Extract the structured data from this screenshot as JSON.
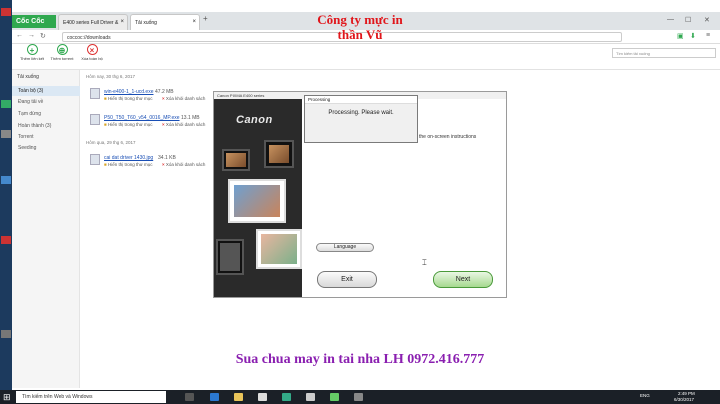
{
  "overlay": {
    "title_line1": "Công ty mực in",
    "title_line2": "thần Vũ",
    "bottom_text": "Sua chua may in tai nha LH 0972.416.777"
  },
  "browser": {
    "logo": "Cốc Cốc",
    "tabs": [
      {
        "label": "E400 series Full Driver &"
      },
      {
        "label": "Tải xuống"
      }
    ],
    "new_tab": "+",
    "url": "coccoc://downloads",
    "search_placeholder": "Tìm kiếm tải xuống"
  },
  "toolbar": {
    "add_link": "Thêm liên kết",
    "add_torrent": "Thêm torrent",
    "delete_all": "Xóa toàn bộ"
  },
  "sidebar": {
    "header": "Tải xuống",
    "items": [
      {
        "label": "Toàn bộ (3)"
      },
      {
        "label": "Đang tải về"
      },
      {
        "label": "Tạm dừng"
      },
      {
        "label": "Hoàn thành (3)"
      },
      {
        "label": "Torrent"
      },
      {
        "label": "Seeding"
      }
    ]
  },
  "downloads": {
    "group_today": "Hôm nay, 30 thg 6, 2017",
    "group_yesterday": "Hôm qua, 29 thg 6, 2017",
    "items": [
      {
        "name": "win-e400-1_1-ucd.exe",
        "size": "47.2 MB",
        "show": "Hiển thị trong thư mục",
        "delete": "Xóa khỏi danh sách"
      },
      {
        "name": "P50_T50_T60_v54_0016_MP.exe",
        "size": "13.1 MB",
        "show": "Hiển thị trong thư mục",
        "delete": "Xóa khỏi danh sách"
      },
      {
        "name": "cai dat driver 1430.jpg",
        "size": "34.1 KB",
        "show": "Hiển thị trong thư mục",
        "delete": "Xóa khỏi danh sách"
      }
    ]
  },
  "installer": {
    "title": "Canon PIXMA E400 series",
    "brand": "Canon",
    "instruction": "the on-screen instructions",
    "language_button": "Language",
    "exit_button": "Exit",
    "next_button": "Next"
  },
  "processing_dialog": {
    "title": "Processing",
    "message": "Processing. Please wait."
  },
  "taskbar": {
    "search": "Tìm kiếm trên Web và Windows",
    "lang": "ENG",
    "time": "2:49 PM",
    "date": "6/30/2017"
  },
  "colors": {
    "accent": "#2fa84f",
    "overlay_red": "#e0161b",
    "overlay_purple": "#8a1fb0"
  }
}
